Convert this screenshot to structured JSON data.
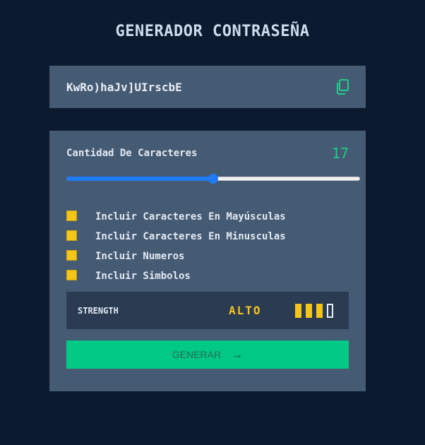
{
  "title": "GENERADOR CONTRASEÑA",
  "password": {
    "value": "KwRo)haJv]UIrscbE",
    "copy_icon": "copy-icon"
  },
  "length": {
    "label": "Cantidad De Caracteres",
    "value": "17",
    "slider_fraction": 0.5
  },
  "options": [
    {
      "label": "Incluir Caracteres En Mayúsculas",
      "checked": true
    },
    {
      "label": "Incluir Caracteres En Minusculas",
      "checked": true
    },
    {
      "label": "Incluir Numeros",
      "checked": true
    },
    {
      "label": "Incluir Simbolos",
      "checked": true
    }
  ],
  "strength": {
    "label": "STRENGTH",
    "value": "ALTO",
    "filled_bars": 3,
    "total_bars": 4
  },
  "generate": {
    "label": "GENERAR",
    "icon": "arrow-right-icon"
  },
  "colors": {
    "background": "#0b1a2e",
    "panel": "#455a73",
    "accent": "#00c985",
    "warning": "#f5c518",
    "slider": "#1e7bf5"
  }
}
